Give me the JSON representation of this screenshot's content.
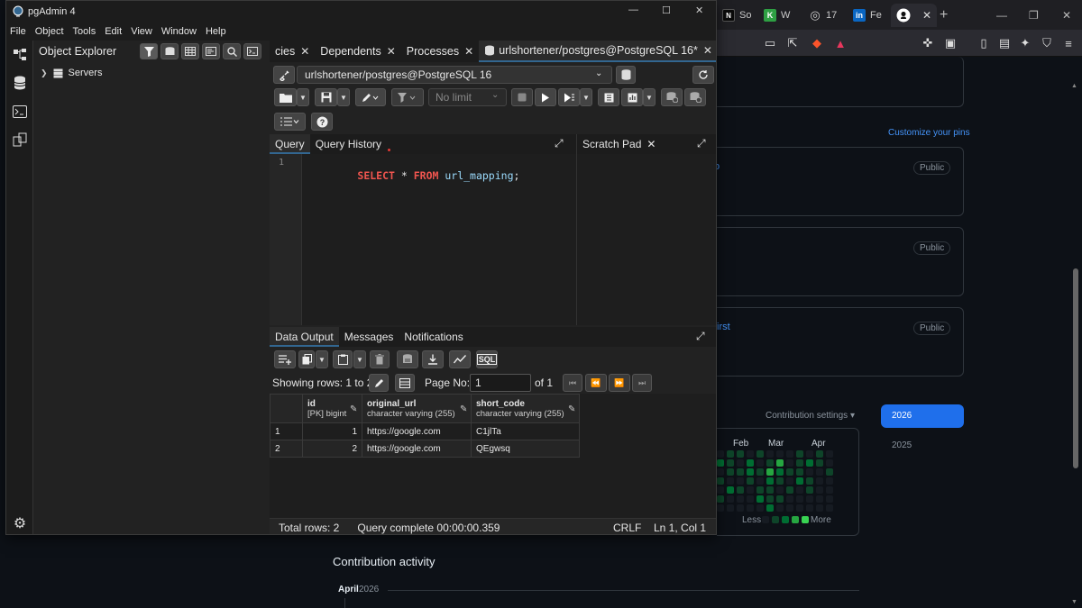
{
  "app": {
    "title": "pgAdmin 4",
    "menu": [
      "File",
      "Object",
      "Tools",
      "Edit",
      "View",
      "Window",
      "Help"
    ],
    "window_controls": {
      "minimize": "—",
      "maximize": "☐",
      "close": "✕"
    }
  },
  "object_explorer": {
    "title": "Object Explorer",
    "tree": [
      {
        "label": "Servers",
        "expanded": false
      }
    ]
  },
  "tabs": [
    {
      "label": "cies",
      "closable": true
    },
    {
      "label": "Dependents",
      "closable": true
    },
    {
      "label": "Processes",
      "closable": true
    },
    {
      "label": "urlshortener/postgres@PostgreSQL 16*",
      "closable": true,
      "active": true
    }
  ],
  "connection": {
    "label": "urlshortener/postgres@PostgreSQL 16"
  },
  "query_toolbar": {
    "limit": "No limit"
  },
  "editor": {
    "tabs": [
      "Query",
      "Query History"
    ],
    "lines": [
      {
        "num": "1",
        "tokens": [
          {
            "text": "SELECT",
            "kind": "kw"
          },
          {
            "text": " * ",
            "kind": "op"
          },
          {
            "text": "FROM",
            "kind": "kw"
          },
          {
            "text": " url_mapping",
            "kind": "ident"
          },
          {
            "text": ";",
            "kind": "op"
          }
        ]
      }
    ],
    "scratch_pad": "Scratch Pad"
  },
  "results": {
    "tabs": [
      "Data Output",
      "Messages",
      "Notifications"
    ],
    "sql_button": "SQL",
    "pager": {
      "showing": "Showing rows: 1 to 2",
      "page_label": "Page No:",
      "page_value": "1",
      "of": "of 1"
    },
    "columns": [
      {
        "name": "id",
        "type": "[PK] bigint"
      },
      {
        "name": "original_url",
        "type": "character varying (255)"
      },
      {
        "name": "short_code",
        "type": "character varying (255)"
      }
    ],
    "rows": [
      {
        "n": "1",
        "id": "1",
        "original_url": "https://google.com",
        "short_code": "C1jlTa"
      },
      {
        "n": "2",
        "id": "2",
        "original_url": "https://google.com",
        "short_code": "QEgwsq"
      }
    ]
  },
  "statusbar": {
    "total": "Total rows: 2",
    "query": "Query complete 00:00:00.359",
    "eol": "CRLF",
    "position": "Ln 1, Col 1"
  },
  "browser": {
    "tabs": [
      {
        "label": "So",
        "icon": "N",
        "color": "#ffffff",
        "bg": "#0a0a0a"
      },
      {
        "label": "W",
        "icon": "K",
        "color": "#ffffff",
        "bg": "#2ea043"
      },
      {
        "label": "17",
        "icon": "◎",
        "color": "#cccccc",
        "bg": "transparent"
      },
      {
        "label": "Fe",
        "icon": "in",
        "color": "#ffffff",
        "bg": "#0a66c2"
      },
      {
        "label": "",
        "icon": "●",
        "color": "#ffffff",
        "bg": "transparent",
        "active": true
      }
    ],
    "github": {
      "customize_pins": "Customize your pins",
      "pin_snippets": [
        "o",
        "first"
      ],
      "public": "Public",
      "contribution_settings": "Contribution settings ▾",
      "years": [
        "2026",
        "2025"
      ],
      "months": [
        "Feb",
        "Mar",
        "Apr"
      ],
      "legend_less": "Less",
      "legend_more": "More",
      "activity_title": "Contribution activity",
      "activity_month": "April",
      "activity_year": "2026"
    }
  }
}
